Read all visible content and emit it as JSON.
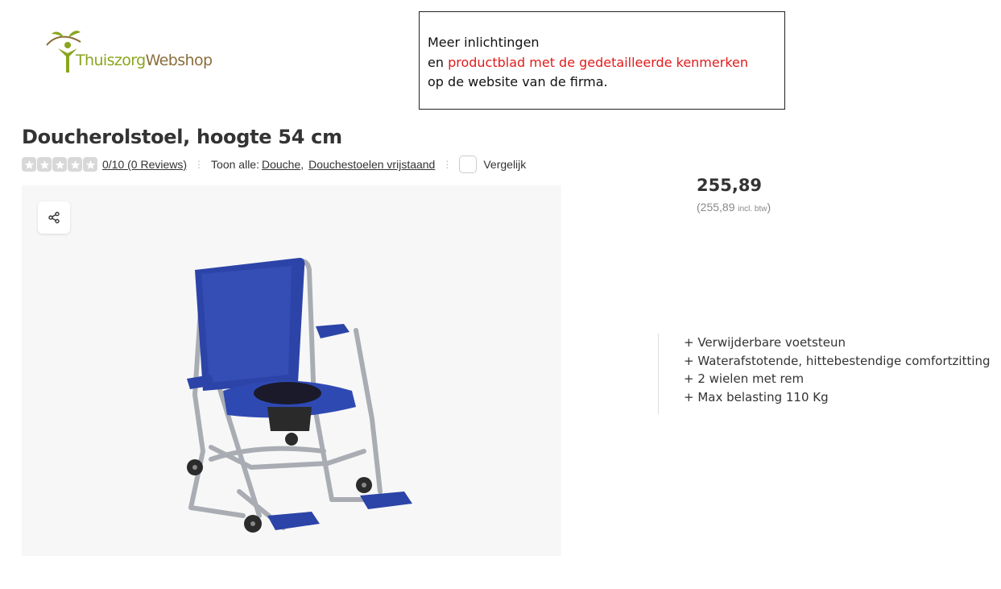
{
  "logo": {
    "name_part1": "Thuiszorg",
    "name_part2": "Webshop",
    "icon": "person-leaf-logo-icon"
  },
  "info_box": {
    "line1": "Meer inlichtingen",
    "line2_prefix": "en ",
    "line2_highlight": "productblad met de gedetailleerde kenmerken",
    "line3": "op de website van de firma.",
    "highlight_color": "#e01b1b"
  },
  "product": {
    "title": "Doucherolstoel, hoogte 54 cm",
    "rating_text": "0/10 (0 Reviews)",
    "rating_value": 0,
    "rating_max": 5,
    "show_all_label": "Toon alle:",
    "categories": [
      "Douche",
      "Douchestoelen vrijstaand"
    ],
    "category_separator": ",",
    "compare_label": "Vergelijk",
    "price": "255,89",
    "price_incl_open": "(255,89",
    "price_incl_note": "incl. btw",
    "price_incl_close": ")",
    "features": [
      "+ Verwijderbare voetsteun",
      "+ Waterafstotende, hittebestendige comfortzitting",
      "+ 2 wielen met rem",
      "+ Max belasting 110 Kg"
    ]
  },
  "icons": {
    "share": "share-icon",
    "star": "star-icon",
    "image": "shower-commode-chair-image"
  },
  "colors": {
    "logo_green": "#8aa51e",
    "logo_brown": "#8a6d3b",
    "chair_blue": "#2c44a8",
    "star_empty": "#d8d8d8"
  }
}
